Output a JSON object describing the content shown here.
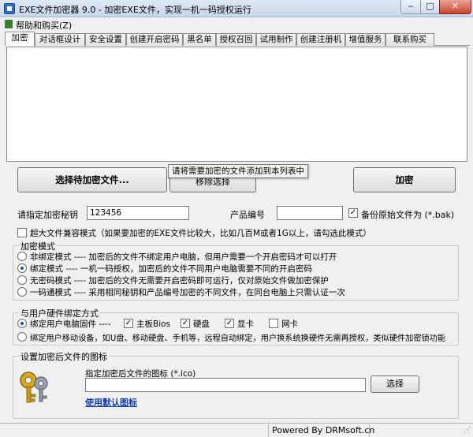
{
  "window": {
    "title": "EXE文件加密器 9.0 - 加密EXE文件，实现一机一码授权运行"
  },
  "menu": {
    "help": "帮助和购买(Z)"
  },
  "tabs": [
    {
      "label": "加密"
    },
    {
      "label": "对话框设计"
    },
    {
      "label": "安全设置"
    },
    {
      "label": "创建开启密码"
    },
    {
      "label": "黑名单"
    },
    {
      "label": "授权召回"
    },
    {
      "label": "试用制作"
    },
    {
      "label": "创建注册机"
    },
    {
      "label": "增值服务"
    },
    {
      "label": "联系购买"
    }
  ],
  "actions": {
    "select_files": "选择待加密文件...",
    "remove_selected": "移除选择",
    "encrypt": "加密",
    "tooltip": "请将需要加密的文件添加到本列表中"
  },
  "key_row": {
    "secret_label": "请指定加密秘钥",
    "secret_value": "123456",
    "product_label": "产品编号",
    "product_value": "",
    "backup_label": "备份原始文件为 (*.bak)"
  },
  "large_file": {
    "label": "超大文件兼容模式（如果要加密的EXE文件比较大，比如几百M或者1G以上，请勾选此模式）"
  },
  "encrypt_mode": {
    "legend": "加密模式",
    "options": [
      "非绑定模式 ---- 加密后的文件不绑定用户电脑，但用户需要一个开启密码才可以打开",
      "绑定模式 ---- 一机一码授权，加密后的文件不同用户电脑需要不同的开启密码",
      "无密码模式 ---- 加密后的文件无需要开启密码即可运行，仅对原始文件做加密保护",
      "一码通模式 ---- 采用相同秘钥和产品编号加密的不同文件，在同台电脑上只需认证一次"
    ]
  },
  "hardware": {
    "legend": "与用户硬件绑定方式",
    "fixed_label": "绑定用户电脑固件 ----",
    "components": [
      "主板Bios",
      "硬盘",
      "显卡",
      "网卡"
    ],
    "mobile_label": "绑定用户移动设备，如U盘、移动硬盘、手机等，远程自动绑定，用户换系统换硬件无需再授权，类似硬件加密锁功能"
  },
  "icon_section": {
    "legend": "设置加密后文件的图标",
    "path_label": "指定加密后文件的图标 (*.ico)",
    "path_value": "",
    "browse": "选择",
    "default_link": "使用默认图标"
  },
  "status": {
    "powered_by": "Powered By DRMsoft.cn"
  },
  "colors": {
    "accent_link": "#1a3ea8",
    "close_button": "#c8442f"
  }
}
